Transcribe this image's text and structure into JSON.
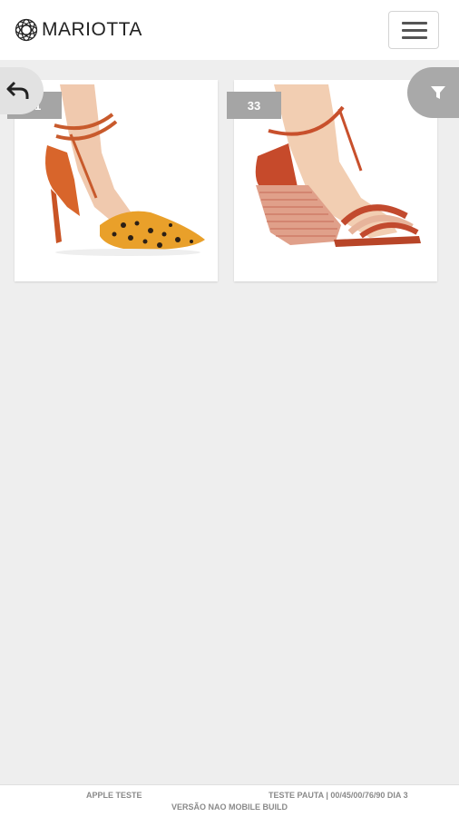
{
  "header": {
    "brand": "MARIOTTA",
    "menu_icon": "hamburger-icon"
  },
  "controls": {
    "back_icon": "back-arrow-icon",
    "filter_icon": "filter-icon"
  },
  "products": [
    {
      "badge": "31",
      "image": "orange pointed-toe heel with leopard print"
    },
    {
      "badge": "33",
      "image": "red woven wedge sandal"
    }
  ],
  "footer": {
    "left": "APPLE TESTE",
    "right": "TESTE PAUTA | 00/45/00/76/90 DIA 3",
    "center": "VERSÃO NAO MOBILE BUILD"
  },
  "colors": {
    "background": "#eeeeee",
    "badge": "#a5a5a5",
    "filter": "#a9a9a9"
  }
}
